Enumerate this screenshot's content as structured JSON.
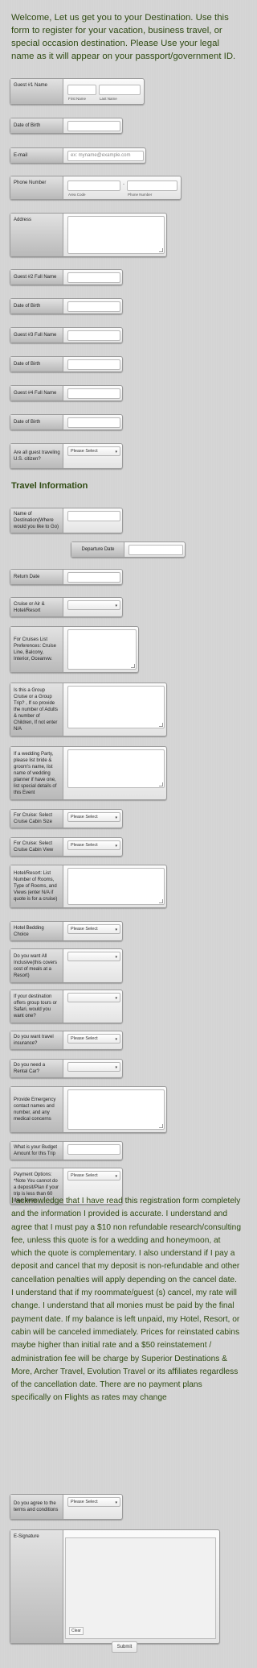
{
  "intro": "Welcome, Let us get you to your Destination. Use this form to register for your vacation, business travel, or special occasion destination. Please Use your legal name as it will appear on your passport/government ID.",
  "fields": {
    "guest1_name": {
      "label": "Guest #1 Name",
      "first_sub": "First Name",
      "last_sub": "Last Name"
    },
    "dob1": {
      "label": "Date of Birth"
    },
    "email": {
      "label": "E-mail",
      "placeholder": "ex: myname@example.com"
    },
    "phone": {
      "label": "Phone Number",
      "area_sub": "Area Code",
      "number_sub": "Phone Number",
      "dash": "-"
    },
    "address": {
      "label": "Address"
    },
    "guest2": {
      "label": "Guest #2 Full Name"
    },
    "dob2": {
      "label": "Date of Birth"
    },
    "guest3": {
      "label": "Guest #3 Full Name"
    },
    "dob3": {
      "label": "Date of Birth"
    },
    "guest4": {
      "label": "Guest #4 Full Name"
    },
    "dob4": {
      "label": "Date of Birth"
    },
    "us_citizen": {
      "label": "Are all guest traveling U.S. citizen?",
      "value": "Please Select"
    }
  },
  "travel_title": "Travel Information",
  "travel": {
    "destination": {
      "label": "Name of Destination(Where would you like to Go)"
    },
    "departure": {
      "label": "Departure Date"
    },
    "return": {
      "label": "Return Date"
    },
    "cruise_or_air": {
      "label": "Cruise or Air & Hotel/Resort",
      "value": ""
    },
    "cruise_prefs": {
      "label": "For Cruises List Preferences: Cruise Line, Balcony, Interior, Oceanvw."
    },
    "group": {
      "label": "Is this a Group Cruise or a Group Trip? , If so provide the number of Adults & number of Children, If not enter N/A"
    },
    "wedding": {
      "label": "If a wedding Party, please list bride & groom's name, list name of wedding planner if have one, list special details of this Event"
    },
    "cabin_size": {
      "label": "For Cruise: Select Cruise Cabin Size",
      "value": "Please Select"
    },
    "cabin_view": {
      "label": "For Cruise: Select Cruise Cabin View",
      "value": "Please Select"
    },
    "hotel_rooms": {
      "label": "Hotel/Resort: List Number of Rooms, Type of Rooms, and Views (enter N/A if quote is for a cruise)"
    },
    "bedding": {
      "label": "Hotel Bedding Choice",
      "value": "Please Select"
    },
    "all_inclusive": {
      "label": "Do you want All Inclusive(this covers cost of meals at a Resort)",
      "value": ""
    },
    "tours": {
      "label": "If your destination offers group tours or Safari, would you want one?",
      "value": ""
    },
    "insurance": {
      "label": "Do you want travel insurance?",
      "value": "Please Select"
    },
    "rental": {
      "label": "Do you need a Rental Car?",
      "value": ""
    },
    "emergency": {
      "label": "Provide Emergency contact names and number, and any medical concerns"
    },
    "budget": {
      "label": "What is your Budget Amount for this Trip"
    },
    "payment": {
      "label": "Payment Options: *Note You cannot do a deposit/Plan if your trip is less than 60 days away",
      "value": "Please Select"
    }
  },
  "acknowledgement": "I acknowledge that I have read this registration form completely and the information I provided is accurate. I understand and agree that I must pay a $10 non refundable research/consulting fee, unless this quote is for a wedding and honeymoon, at which the quote is complementary. I also understand if I pay a deposit and cancel that my deposit is non-refundable and other cancellation penalties will apply depending on the cancel date. I understand that if my roommate/guest (s) cancel, my rate will change. I understand that all monies must be paid by the final payment date. If my balance is left unpaid, my Hotel, Resort, or cabin will be canceled immediately. Prices for reinstated cabins maybe higher than initial rate and a $50 reinstatement / administration fee will be charge by Superior Destinations & More, Archer Travel, Evolution Travel or its affiliates regardless of the cancellation date. There are no payment plans specifically on Flights as rates may change",
  "agree": {
    "label": "Do you agree to the terms and conditions",
    "value": "Please Select"
  },
  "signature": {
    "label": "E-Signature",
    "clear": "Clear"
  },
  "submit": "Submit"
}
